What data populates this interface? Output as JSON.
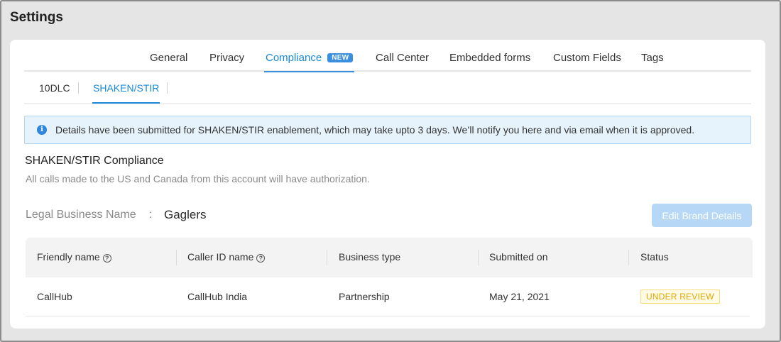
{
  "page": {
    "title": "Settings"
  },
  "top_tabs": [
    {
      "label": "General",
      "active": false
    },
    {
      "label": "Privacy",
      "active": false
    },
    {
      "label": "Compliance",
      "active": true,
      "badge": "NEW"
    },
    {
      "label": "Call Center",
      "active": false
    },
    {
      "label": "Embedded forms",
      "active": false
    },
    {
      "label": "Custom Fields",
      "active": false
    },
    {
      "label": "Tags",
      "active": false
    }
  ],
  "sub_tabs": [
    {
      "label": "10DLC",
      "active": false
    },
    {
      "label": "SHAKEN/STIR",
      "active": true
    }
  ],
  "banner": {
    "icon": "info-icon",
    "text": "Details have been submitted for SHAKEN/STIR enablement, which may take upto 3 days. We’ll notify you here and via email when it is approved."
  },
  "section": {
    "title": "SHAKEN/STIR Compliance",
    "subtitle": "All calls made to the US and Canada from this account will have authorization."
  },
  "legal": {
    "label": "Legal Business Name",
    "separator": ":",
    "value": "Gaglers"
  },
  "edit_button": {
    "label": "Edit Brand Details"
  },
  "table": {
    "headers": [
      "Friendly name",
      "Caller ID name",
      "Business type",
      "Submitted on",
      "Status"
    ],
    "rows": [
      {
        "friendly_name": "CallHub",
        "caller_id_name": "CallHub India",
        "business_type": "Partnership",
        "submitted_on": "May 21, 2021",
        "status": "UNDER REVIEW"
      }
    ]
  },
  "colors": {
    "accent": "#1a8ad8",
    "badge": "#3b8fe0",
    "banner_bg": "#e6f3fd",
    "button_disabled": "#b6d8f6",
    "status_warning": "#e0a800"
  }
}
